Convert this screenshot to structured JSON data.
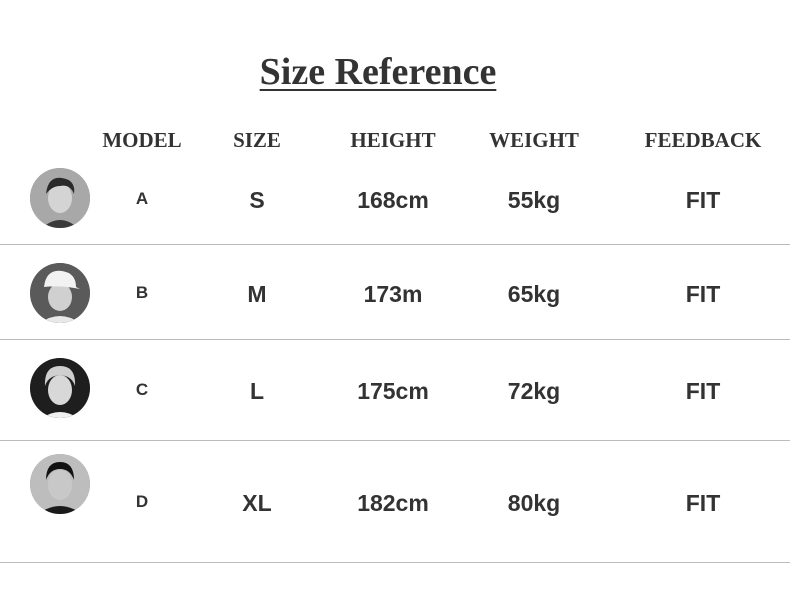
{
  "title": "Size Reference",
  "headers": {
    "model": "MODEL",
    "size": "SIZE",
    "height": "HEIGHT",
    "weight": "WEIGHT",
    "feedback": "FEEDBACK"
  },
  "rows": [
    {
      "model": "A",
      "size": "S",
      "height": "168cm",
      "weight": "55kg",
      "feedback": "FIT"
    },
    {
      "model": "B",
      "size": "M",
      "height": "173m",
      "weight": "65kg",
      "feedback": "FIT"
    },
    {
      "model": "C",
      "size": "L",
      "height": "175cm",
      "weight": "72kg",
      "feedback": "FIT"
    },
    {
      "model": "D",
      "size": "XL",
      "height": "182cm",
      "weight": "80kg",
      "feedback": "FIT"
    }
  ],
  "colors": {
    "text": "#333333",
    "divider": "#bcbcbc",
    "background": "#ffffff"
  },
  "icons": [
    "model-a-photo",
    "model-b-photo",
    "model-c-photo",
    "model-d-photo"
  ]
}
